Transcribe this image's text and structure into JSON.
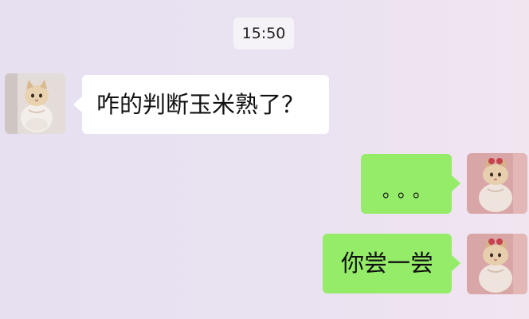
{
  "chat": {
    "timestamp": "15:50",
    "messages": [
      {
        "side": "left",
        "text": "咋的判断玉米熟了？"
      },
      {
        "side": "right",
        "text": "。。。"
      },
      {
        "side": "right",
        "text": "你尝一尝"
      }
    ]
  },
  "avatars": {
    "left": {
      "icon": "cat-avatar-icon",
      "background": "#e3dcd8"
    },
    "right": {
      "icon": "cat-avatar-icon",
      "background": "#d9a6a8"
    }
  },
  "colors": {
    "incoming_bubble": "#ffffff",
    "outgoing_bubble": "#95ec69",
    "timestamp_bg": "#f6f3f8"
  }
}
